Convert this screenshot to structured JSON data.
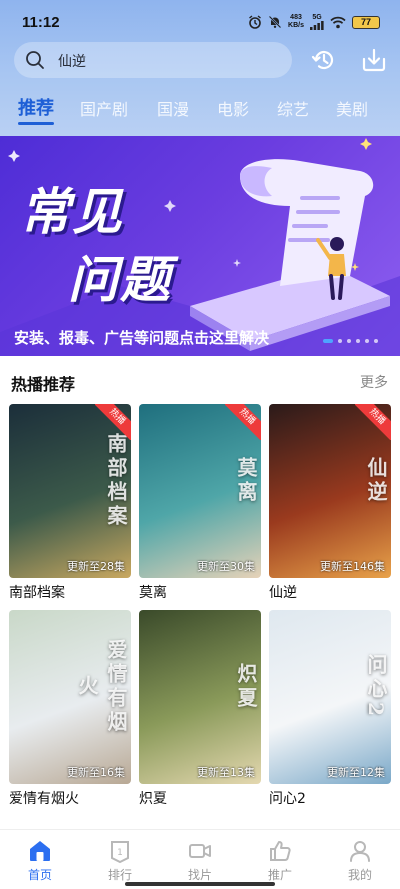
{
  "status_bar": {
    "time": "11:12",
    "net_speed_value": "483",
    "net_speed_unit": "KB/s",
    "signal": "5G",
    "battery": "77"
  },
  "search": {
    "query": "仙逆"
  },
  "tabs": [
    {
      "label": "推荐",
      "active": true
    },
    {
      "label": "国产剧",
      "active": false
    },
    {
      "label": "国漫",
      "active": false
    },
    {
      "label": "电影",
      "active": false
    },
    {
      "label": "综艺",
      "active": false
    },
    {
      "label": "美剧",
      "active": false
    }
  ],
  "banner": {
    "title_line1": "常见",
    "title_line2": "问题",
    "caption": "安装、报毒、广告等问题点击这里解决",
    "slide_count": 6,
    "active_slide": 0
  },
  "section": {
    "title": "热播推荐",
    "more_label": "更多"
  },
  "cards": [
    {
      "title": "南部档案",
      "update": "更新至28集",
      "badge": "热播",
      "poster_text": "南部档案",
      "colors": [
        "#1b2e3a",
        "#3c5a4a",
        "#c9a860"
      ]
    },
    {
      "title": "莫离",
      "update": "更新至30集",
      "badge": "热播",
      "poster_text": "莫离",
      "colors": [
        "#1f6f7e",
        "#4fa6a8",
        "#e6d2b8"
      ]
    },
    {
      "title": "仙逆",
      "update": "更新至146集",
      "badge": "热播",
      "poster_text": "仙逆",
      "colors": [
        "#2a1a1a",
        "#9a3a1e",
        "#e8a24a"
      ]
    },
    {
      "title": "爱情有烟火",
      "update": "更新至16集",
      "badge": "",
      "poster_text": "爱情有烟火",
      "colors": [
        "#c9d8c8",
        "#e8ecef",
        "#b8a894"
      ]
    },
    {
      "title": "炽夏",
      "update": "更新至13集",
      "badge": "",
      "poster_text": "炽夏",
      "colors": [
        "#3a4a2a",
        "#8a9a5a",
        "#e4d8b0"
      ]
    },
    {
      "title": "问心2",
      "update": "更新至12集",
      "badge": "",
      "poster_text": "问心2",
      "colors": [
        "#dfe8ef",
        "#f4f6f8",
        "#7aa8c8"
      ]
    }
  ],
  "bottom_nav": [
    {
      "label": "首页",
      "icon": "home-icon",
      "active": true
    },
    {
      "label": "排行",
      "icon": "ranking-icon",
      "active": false
    },
    {
      "label": "找片",
      "icon": "video-camera-icon",
      "active": false
    },
    {
      "label": "推广",
      "icon": "thumbs-up-icon",
      "active": false
    },
    {
      "label": "我的",
      "icon": "profile-icon",
      "active": false
    }
  ],
  "colors": {
    "accent": "#2c6ff0",
    "tab_active": "#1e5fd6",
    "hot_badge": "#ee3b3b"
  }
}
